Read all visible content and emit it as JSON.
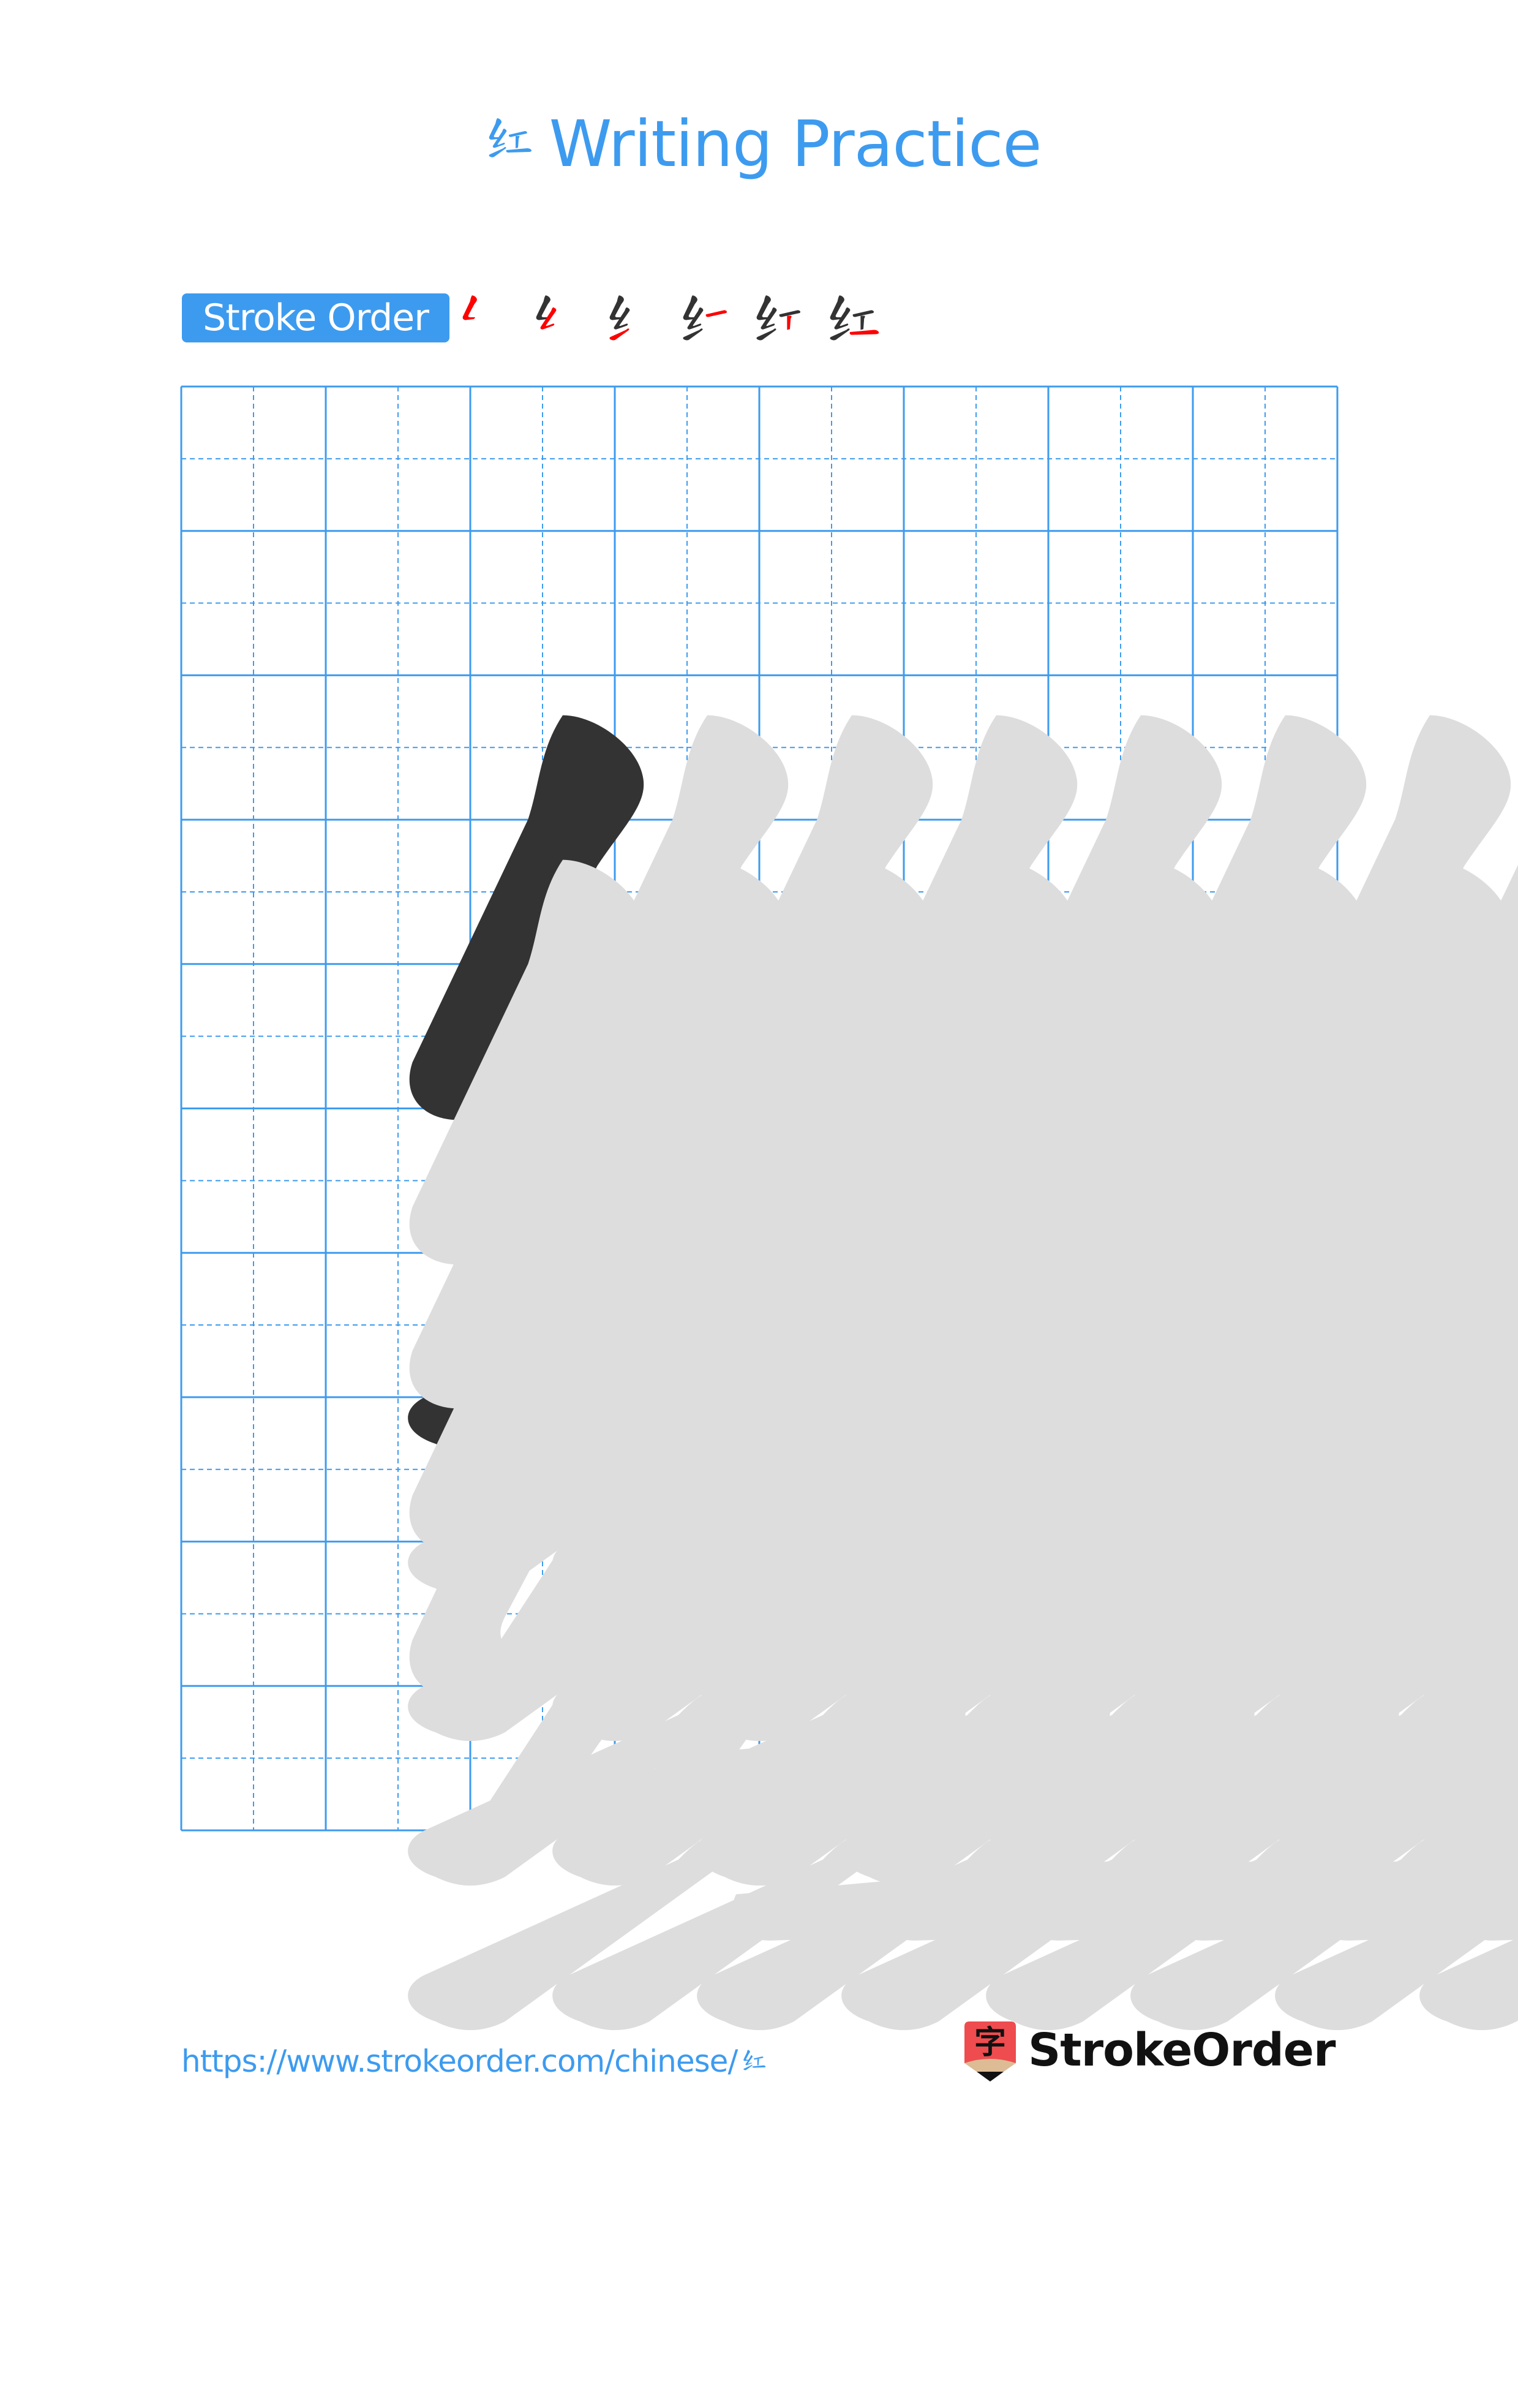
{
  "document": {
    "title_char": "红",
    "title_text": "Writing Practice",
    "colors": {
      "accent": "#3d9bef",
      "grid_line": "#3d9bef",
      "model_char": "#333333",
      "trace_char": "#dddddd",
      "stroke_highlight": "#ff0000",
      "logo_red": "#ef4c4f",
      "logo_tan": "#ddbb94"
    }
  },
  "stroke_order": {
    "label": "Stroke Order",
    "character": "红",
    "stroke_count": 6,
    "steps": [
      {
        "step": 1,
        "highlight_stroke": 1
      },
      {
        "step": 2,
        "highlight_stroke": 2
      },
      {
        "step": 3,
        "highlight_stroke": 3
      },
      {
        "step": 4,
        "highlight_stroke": 4
      },
      {
        "step": 5,
        "highlight_stroke": 5
      },
      {
        "step": 6,
        "highlight_stroke": 6
      }
    ]
  },
  "practice_grid": {
    "character": "红",
    "columns": 8,
    "rows": 10,
    "model_cells": 1,
    "traced_rows": 5,
    "empty_rows": 5,
    "cell_guides": "dashed horizontal and vertical midlines"
  },
  "footer": {
    "url_prefix": "https://www.strokeorder.com/chinese/",
    "url_char": "红",
    "logo_glyph": "字",
    "logo_text": "StrokeOrder"
  }
}
